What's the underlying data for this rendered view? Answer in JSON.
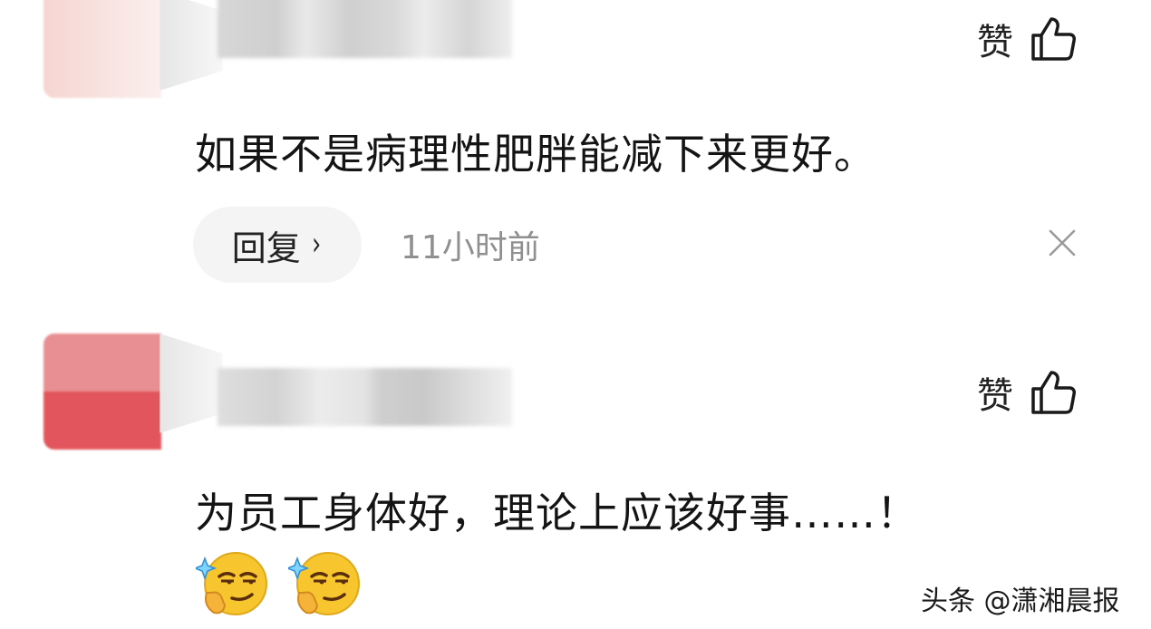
{
  "comments": [
    {
      "like_label": "赞",
      "text": "如果不是病理性肥胖能减下来更好。",
      "reply_label": "回复",
      "reply_chevron": "›",
      "time": "11小时前"
    },
    {
      "like_label": "赞",
      "text": "为员工身体好，理论上应该好事……！",
      "emojis": [
        "smirk-emoji",
        "smirk-emoji"
      ]
    }
  ],
  "watermark": "头条 @潇湘晨报",
  "colors": {
    "text": "#141414",
    "muted": "#8f8f8f",
    "pill": "#f4f4f4",
    "avatar_red": "#e2555c",
    "avatar_pink": "#f6d5d1"
  }
}
